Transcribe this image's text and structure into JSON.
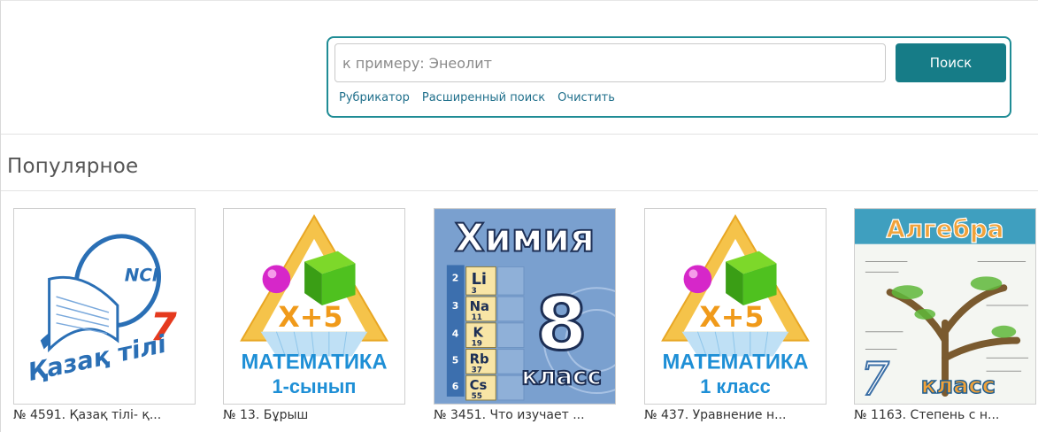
{
  "search": {
    "placeholder": "к примеру: Энеолит",
    "value": "",
    "button_label": "Поиск",
    "links": [
      "Рубрикатор",
      "Расширенный поиск",
      "Очистить"
    ]
  },
  "popular": {
    "title": "Популярное",
    "items": [
      {
        "caption": "№ 4591. Қазақ тілі- қ...",
        "cover": {
          "text": "Қазақ тілі",
          "number": "7"
        }
      },
      {
        "caption": "№ 13. Бұрыш",
        "cover": {
          "subject": "МАТЕМАТИКА",
          "grade": "1-сынып",
          "badge": "X+5"
        }
      },
      {
        "caption": "№ 3451. Что изучает ...",
        "cover": {
          "subject": "Химия",
          "grade_number": "8",
          "grade_word": "класс",
          "elements": [
            "Li",
            "Na",
            "K",
            "Rb",
            "Cs"
          ],
          "atomic_numbers": [
            "3",
            "11",
            "19",
            "37",
            "55"
          ],
          "period_numbers": [
            "2",
            "3",
            "4",
            "5",
            "6"
          ]
        }
      },
      {
        "caption": "№ 437. Уравнение н...",
        "cover": {
          "subject": "МАТЕМАТИКА",
          "grade": "1 класс",
          "badge": "X+5"
        }
      },
      {
        "caption": "№ 1163. Степень с н...",
        "cover": {
          "subject": "Алгебра",
          "grade_number": "7",
          "grade_word": "класс"
        }
      }
    ]
  },
  "colors": {
    "accent": "#167c87",
    "border_accent": "#1f8c95",
    "link": "#1f6f8b"
  }
}
